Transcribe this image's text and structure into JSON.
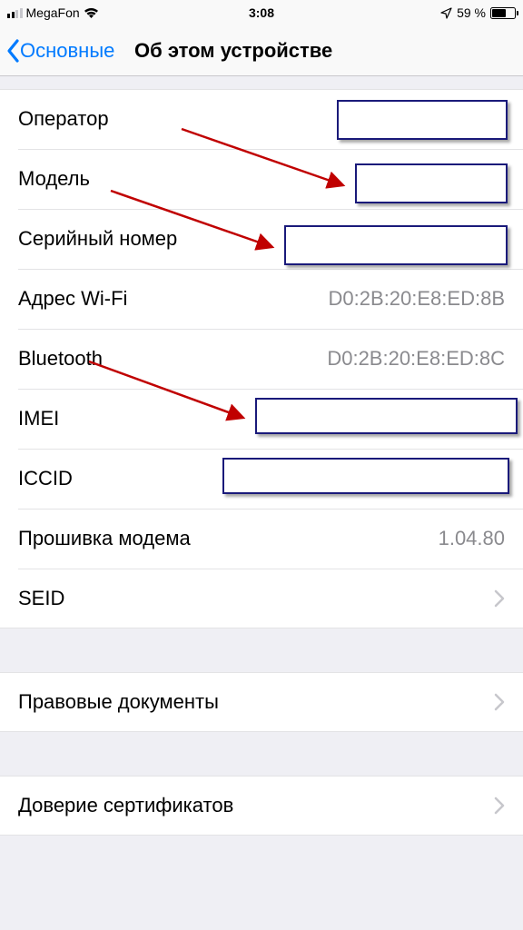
{
  "status": {
    "carrier": "MegaFon",
    "time": "3:08",
    "battery": "59 %"
  },
  "nav": {
    "back": "Основные",
    "title": "Об этом устройстве"
  },
  "rows": {
    "carrier": "Оператор",
    "model": "Модель",
    "serial": "Серийный номер",
    "wifi_label": "Адрес Wi-Fi",
    "wifi_value": "D0:2B:20:E8:ED:8B",
    "bt_label": "Bluetooth",
    "bt_value": "D0:2B:20:E8:ED:8C",
    "imei": "IMEI",
    "iccid": "ICCID",
    "modem_label": "Прошивка модема",
    "modem_value": "1.04.80",
    "seid": "SEID",
    "legal": "Правовые документы",
    "cert": "Доверие сертификатов"
  }
}
